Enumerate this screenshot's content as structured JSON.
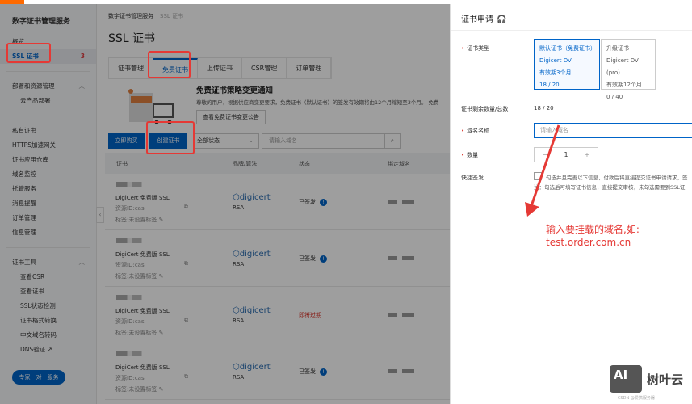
{
  "sidebar": {
    "title": "数字证书管理服务",
    "items": [
      "概览",
      "SSL 证书"
    ],
    "ssl_badge": "3",
    "group1": "部署和资源管理",
    "group1_items": [
      "云产品部署"
    ],
    "items2": [
      "私有证书",
      "HTTPS加速网关",
      "证书应用仓库",
      "域名监控",
      "托管服务",
      "消息提醒",
      "订单管理",
      "信息管理"
    ],
    "group2": "证书工具",
    "group2_items": [
      "查看CSR",
      "查看证书",
      "SSL状态检测",
      "证书格式转换",
      "中文域名转码",
      "DNS验证 ↗"
    ],
    "expert_button": "专家一对一服务"
  },
  "breadcrumb": {
    "root": "数字证书管理服务",
    "current": "SSL 证书"
  },
  "page_title": "SSL 证书",
  "tabs": [
    "证书管理",
    "免费证书",
    "上传证书",
    "CSR管理",
    "订单管理"
  ],
  "notice": {
    "title": "免费证书策略变更通知",
    "text": "尊敬的用户，根据供应商变更要求，免费证书（默认证书）的签发有效期将由12个月缩短至3个月。 免费",
    "button": "查看免费证书变更公告"
  },
  "toolbar": {
    "buy": "立即购买",
    "create": "创建证书",
    "status_filter": "全部状态",
    "search_placeholder": "请输入域名"
  },
  "table": {
    "headers": [
      "证书",
      "品牌/算法",
      "状态",
      "绑定域名"
    ],
    "rows": [
      {
        "name": "DigiCert 免费版 SSL",
        "rid": "资源ID:cas",
        "tag": "标签:未设置标签",
        "brand": "digicert",
        "alg": "RSA",
        "status": "已签发"
      },
      {
        "name": "DigiCert 免费版 SSL",
        "rid": "资源ID:cas",
        "tag": "标签:未设置标签",
        "brand": "digicert",
        "alg": "RSA",
        "status": "已签发"
      },
      {
        "name": "DigiCert 免费版 SSL",
        "rid": "资源ID:cas",
        "tag": "标签:未设置标签",
        "brand": "digicert",
        "alg": "RSA",
        "status": "即将过期"
      },
      {
        "name": "DigiCert 免费版 SSL",
        "rid": "资源ID:cas",
        "tag": "标签:未设置标签",
        "brand": "digicert",
        "alg": "RSA",
        "status": "已签发"
      }
    ]
  },
  "drawer": {
    "title": "证书申请",
    "cert_type_label": "证书类型",
    "cards": [
      {
        "l1": "默认证书（免费证书）",
        "l2": "Digicert DV",
        "l3": "有效期3个月",
        "l4": "18 / 20"
      },
      {
        "l1": "升级证书",
        "l2": "Digicert DV (pro)",
        "l3": "有效期12个月",
        "l4": "0 / 40"
      }
    ],
    "remain_label": "证书剩余数量/总数",
    "remain_value": "18 / 20",
    "domain_label": "域名名称",
    "domain_placeholder": "请输入域名",
    "qty_label": "数量",
    "qty_minus": "−",
    "qty_value": "1",
    "qty_plus": "+",
    "quick_label": "快捷签发",
    "quick_text1": "勾选并且完善以下信息，付款后将直接提交证书申请请求，签",
    "quick_text2": "注：勾选后可填写证书信息，直接提交审核，未勾选需要到SSL证"
  },
  "annotation": {
    "line1": "输入要挂载的域名,如:",
    "line2": "test.order.com.cn"
  },
  "watermark": {
    "logo": "AI",
    "name": "树叶云",
    "csdn": "CSDN @爱搞服务器"
  }
}
